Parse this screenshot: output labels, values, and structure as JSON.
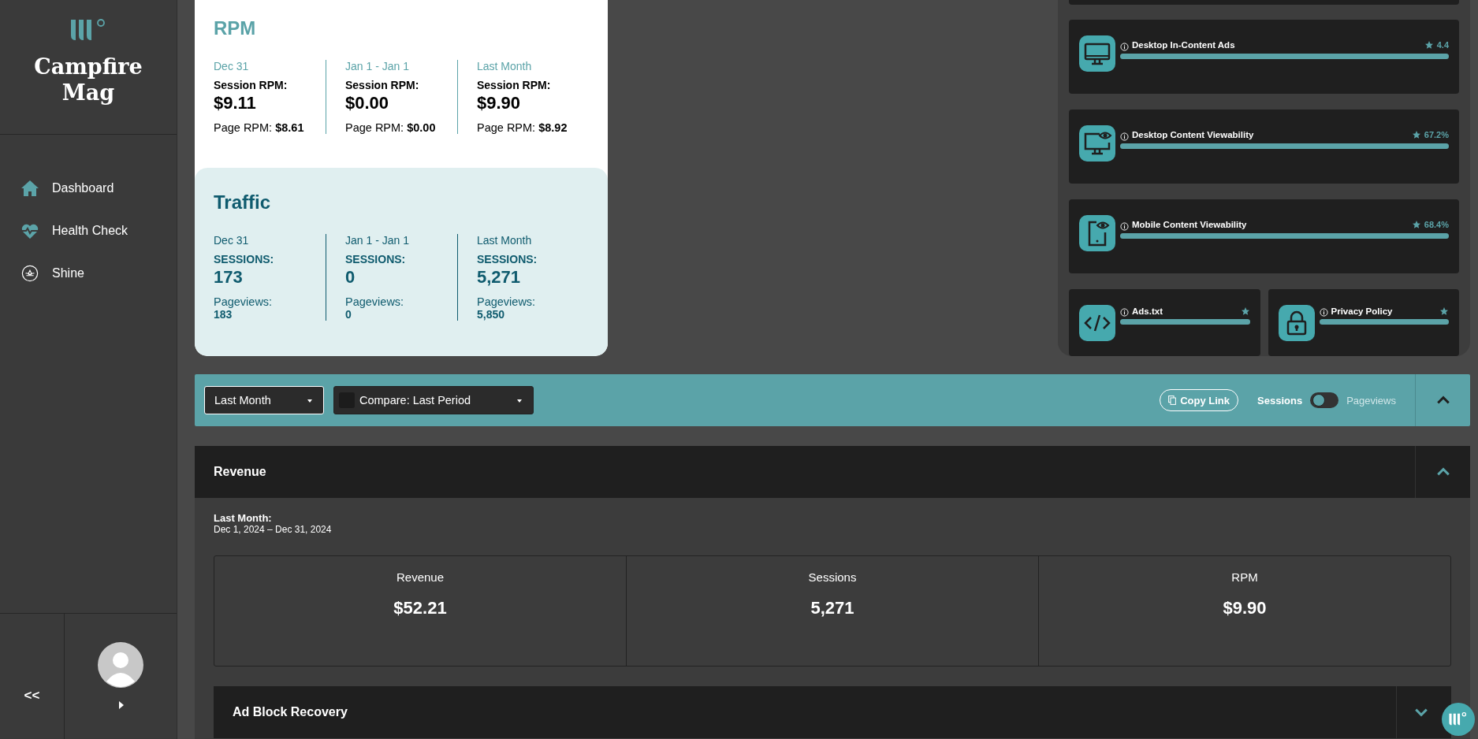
{
  "sidebar": {
    "brand": "Campfire\nMag",
    "nav": [
      {
        "label": "Dashboard",
        "kind": "home"
      },
      {
        "label": "Health Check",
        "kind": "health"
      },
      {
        "label": "Shine",
        "kind": "shine"
      }
    ],
    "collapse": "<<"
  },
  "rpm_card": {
    "title": "RPM",
    "columns": [
      {
        "period": "Dec 31",
        "label": "Session RPM:",
        "value": "$9.11",
        "sub_label": "Page RPM:",
        "sub_value": "$8.61"
      },
      {
        "period": "Jan 1 - Jan 1",
        "label": "Session RPM:",
        "value": "$0.00",
        "sub_label": "Page RPM:",
        "sub_value": "$0.00"
      },
      {
        "period": "Last Month",
        "label": "Session RPM:",
        "value": "$9.90",
        "sub_label": "Page RPM:",
        "sub_value": "$8.92"
      }
    ]
  },
  "traffic_card": {
    "title": "Traffic",
    "columns": [
      {
        "period": "Dec 31",
        "label": "SESSIONS:",
        "value": "173",
        "sub_label": "Pageviews:",
        "sub_value": "183"
      },
      {
        "period": "Jan 1 - Jan 1",
        "label": "SESSIONS:",
        "value": "0",
        "sub_label": "Pageviews:",
        "sub_value": "0"
      },
      {
        "period": "Last Month",
        "label": "SESSIONS:",
        "value": "5,271",
        "sub_label": "Pageviews:",
        "sub_value": "5,850"
      }
    ]
  },
  "health_checks": [
    {
      "kind": "desktop",
      "label": "Desktop In-Content Ads",
      "score": "4.4",
      "level": 1
    },
    {
      "kind": "desktop-eye",
      "label": "Desktop Content Viewability",
      "score": "67.2%",
      "level": 1
    },
    {
      "kind": "mobile-eye",
      "label": "Mobile Content Viewability",
      "score": "68.4%",
      "level": 1
    },
    {
      "kind": "code",
      "label": "Ads.txt",
      "level": 1
    },
    {
      "kind": "lock",
      "label": "Privacy Policy",
      "level": 1
    }
  ],
  "toolbar": {
    "period": "Last Month",
    "compare": {
      "label": "Compare: Last Period",
      "checked": false
    },
    "copy_link": "Copy Link",
    "metric_toggle": [
      {
        "label": "Sessions",
        "selected": true
      },
      {
        "label": "Pageviews",
        "selected": false
      }
    ],
    "expanded": true
  },
  "sections": [
    {
      "title": "Revenue",
      "expanded": true,
      "range_label": "Last Month:",
      "range": "Dec 1, 2024 – Dec 31, 2024",
      "stats": [
        {
          "label": "Revenue",
          "value": "$52.21"
        },
        {
          "label": "Sessions",
          "value": "5,271"
        },
        {
          "label": "RPM",
          "value": "$9.90"
        }
      ]
    },
    {
      "title": "Ad Block Recovery",
      "expanded": false
    }
  ]
}
